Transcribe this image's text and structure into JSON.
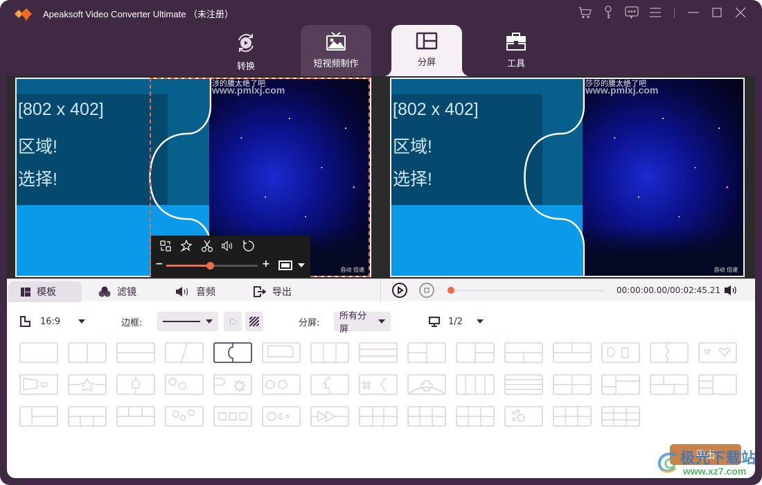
{
  "app": {
    "title": "Apeaksoft Video Converter Ultimate （未注册）",
    "titlebar_icons": [
      "cart-icon",
      "key-icon",
      "feedback-icon",
      "menu-icon"
    ],
    "window_controls": [
      "minimize",
      "maximize",
      "close"
    ]
  },
  "nav": {
    "tabs": [
      {
        "label": "转换",
        "icon": "convert-icon",
        "state": "normal"
      },
      {
        "label": "短视频制作",
        "icon": "mv-icon",
        "state": "hover"
      },
      {
        "label": "分屏",
        "icon": "collage-icon",
        "state": "active"
      },
      {
        "label": "工具",
        "icon": "toolbox-icon",
        "state": "normal"
      }
    ]
  },
  "preview": {
    "video_text": [
      "[802 x 402]",
      "区域!",
      "选择!"
    ],
    "caption_left": "涉的腰太绝了吧",
    "caption_right": "莎莎的腰太绝了吧",
    "url_overlay": "www.pmlxj.com",
    "corner_text": "自动  倍速",
    "clip_controls": {
      "icons": [
        "swap-icon",
        "magic-icon",
        "scissors-icon",
        "volume-icon",
        "rotate-icon"
      ],
      "minus": "−",
      "plus": "+",
      "zoom_fraction": 0.48
    }
  },
  "edit_tabs": [
    {
      "label": "模板",
      "icon": "template-icon",
      "active": true
    },
    {
      "label": "滤镜",
      "icon": "filter-icon",
      "active": false
    },
    {
      "label": "音频",
      "icon": "audio-icon",
      "active": false
    },
    {
      "label": "导出",
      "icon": "export-icon",
      "active": false
    }
  ],
  "player": {
    "timecode": "00:00:00.00/00:02:45.21",
    "progress": 0.0
  },
  "settings": {
    "ratio": "16:9",
    "border_label": "边框:",
    "split_label": "分屏:",
    "split_value": "所有分屏",
    "screen_value": "1/2"
  },
  "templates": {
    "selected_index": 4,
    "count": 43
  },
  "export_button": "导出",
  "watermark": {
    "text": "极光下载站",
    "url": "www.xz7.com"
  },
  "colors": {
    "window_bg": "#402942",
    "accent": "#ef6a4a",
    "template_outline": "#e0cfe2",
    "template_selected": "#3d2a40",
    "export_bg": "#c8834a"
  }
}
